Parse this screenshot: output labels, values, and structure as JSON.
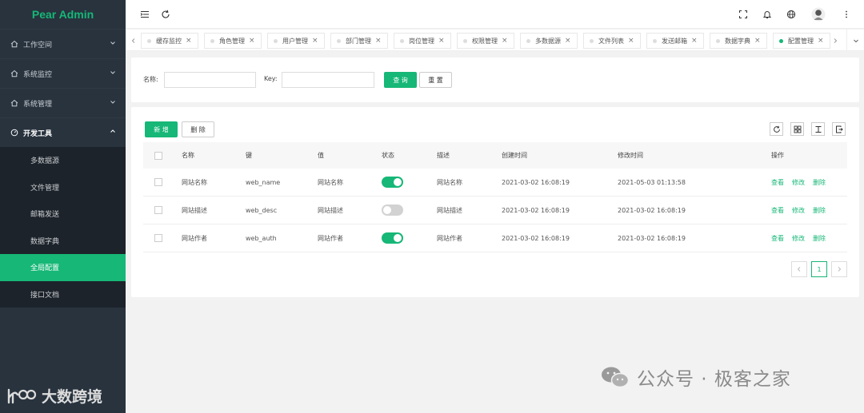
{
  "app": {
    "logo": "Pear Admin"
  },
  "sidebar": {
    "items": [
      {
        "label": "工作空间",
        "icon": "home-icon"
      },
      {
        "label": "系统监控",
        "icon": "home-icon"
      },
      {
        "label": "系统管理",
        "icon": "home-icon"
      },
      {
        "label": "开发工具",
        "icon": "gauge-icon"
      }
    ],
    "subitems": [
      {
        "label": "多数据源"
      },
      {
        "label": "文件管理"
      },
      {
        "label": "邮箱发送"
      },
      {
        "label": "数据字典"
      },
      {
        "label": "全局配置",
        "active": true
      },
      {
        "label": "接口文档"
      }
    ]
  },
  "tabs": [
    {
      "label": "缓存监控"
    },
    {
      "label": "角色管理"
    },
    {
      "label": "用户管理"
    },
    {
      "label": "部门管理"
    },
    {
      "label": "岗位管理"
    },
    {
      "label": "权限管理"
    },
    {
      "label": "多数据源"
    },
    {
      "label": "文件列表"
    },
    {
      "label": "发送邮箱"
    },
    {
      "label": "数据字典"
    },
    {
      "label": "配置管理",
      "active": true
    }
  ],
  "search": {
    "name_label": "名称:",
    "key_label": "Key:",
    "query_button": "查 询",
    "reset_button": "重 置",
    "name_value": "",
    "key_value": ""
  },
  "toolbar": {
    "add_button": "新 增",
    "delete_button": "删 除"
  },
  "table": {
    "headers": [
      "名称",
      "键",
      "值",
      "状态",
      "描述",
      "创建时间",
      "修改时间",
      "操作"
    ],
    "rows": [
      {
        "name": "网站名称",
        "key": "web_name",
        "value": "网站名称",
        "enabled": true,
        "desc": "网站名称",
        "created": "2021-03-02 16:08:19",
        "modified": "2021-05-03 01:13:58"
      },
      {
        "name": "网站描述",
        "key": "web_desc",
        "value": "网站描述",
        "enabled": false,
        "desc": "网站描述",
        "created": "2021-03-02 16:08:19",
        "modified": "2021-03-02 16:08:19"
      },
      {
        "name": "网站作者",
        "key": "web_auth",
        "value": "网站作者",
        "enabled": true,
        "desc": "网站作者",
        "created": "2021-03-02 16:08:19",
        "modified": "2021-03-02 16:08:19"
      }
    ],
    "actions": {
      "view": "查看",
      "edit": "修改",
      "delete": "删除"
    }
  },
  "pagination": {
    "current": "1"
  },
  "watermark": {
    "right_text": "公众号 · 极客之家",
    "left_text": "大数跨境"
  },
  "colors": {
    "accent": "#16b777",
    "sidebar_bg": "#28333e",
    "submenu_bg": "#1d232a"
  }
}
